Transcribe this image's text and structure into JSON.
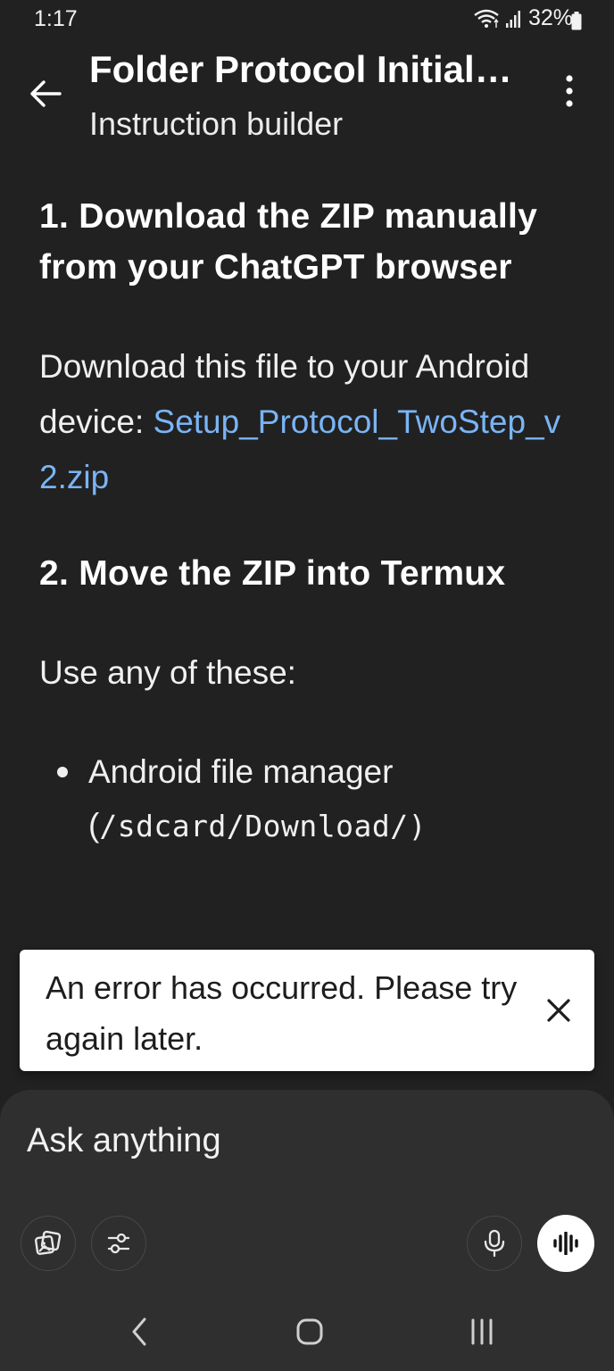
{
  "status_bar": {
    "time": "1:17",
    "battery": "32%"
  },
  "header": {
    "title": "Folder Protocol Initial…",
    "subtitle": "Instruction builder",
    "back_icon": "arrow-left-icon",
    "more_icon": "more-vertical-icon"
  },
  "content": {
    "step1_heading": "1. Download the ZIP manually from your ChatGPT browser",
    "step1_text": "Download this file to your Android device:",
    "file_link": "Setup_Protocol_TwoStep_v2.zip",
    "step2_heading": "2. Move the ZIP into Termux",
    "step2_text": "Use any of these:",
    "bullets": [
      {
        "text": "Android file manager (",
        "path": "/sdcard/Download/",
        "close": ")"
      }
    ]
  },
  "toast": {
    "message": "An error has occurred. Please try again later.",
    "close_icon": "close-icon"
  },
  "composer": {
    "placeholder": "Ask anything",
    "buttons": [
      "attach-image-icon",
      "tools-sliders-icon",
      "microphone-icon",
      "voice-mode-icon"
    ]
  },
  "nav_bar": {
    "buttons": [
      "back-chevron-icon",
      "home-icon",
      "recents-icon"
    ]
  },
  "colors": {
    "background": "#212121",
    "link": "#7ab4f5",
    "composer": "#2f2f2f",
    "toast": "#ffffff"
  }
}
